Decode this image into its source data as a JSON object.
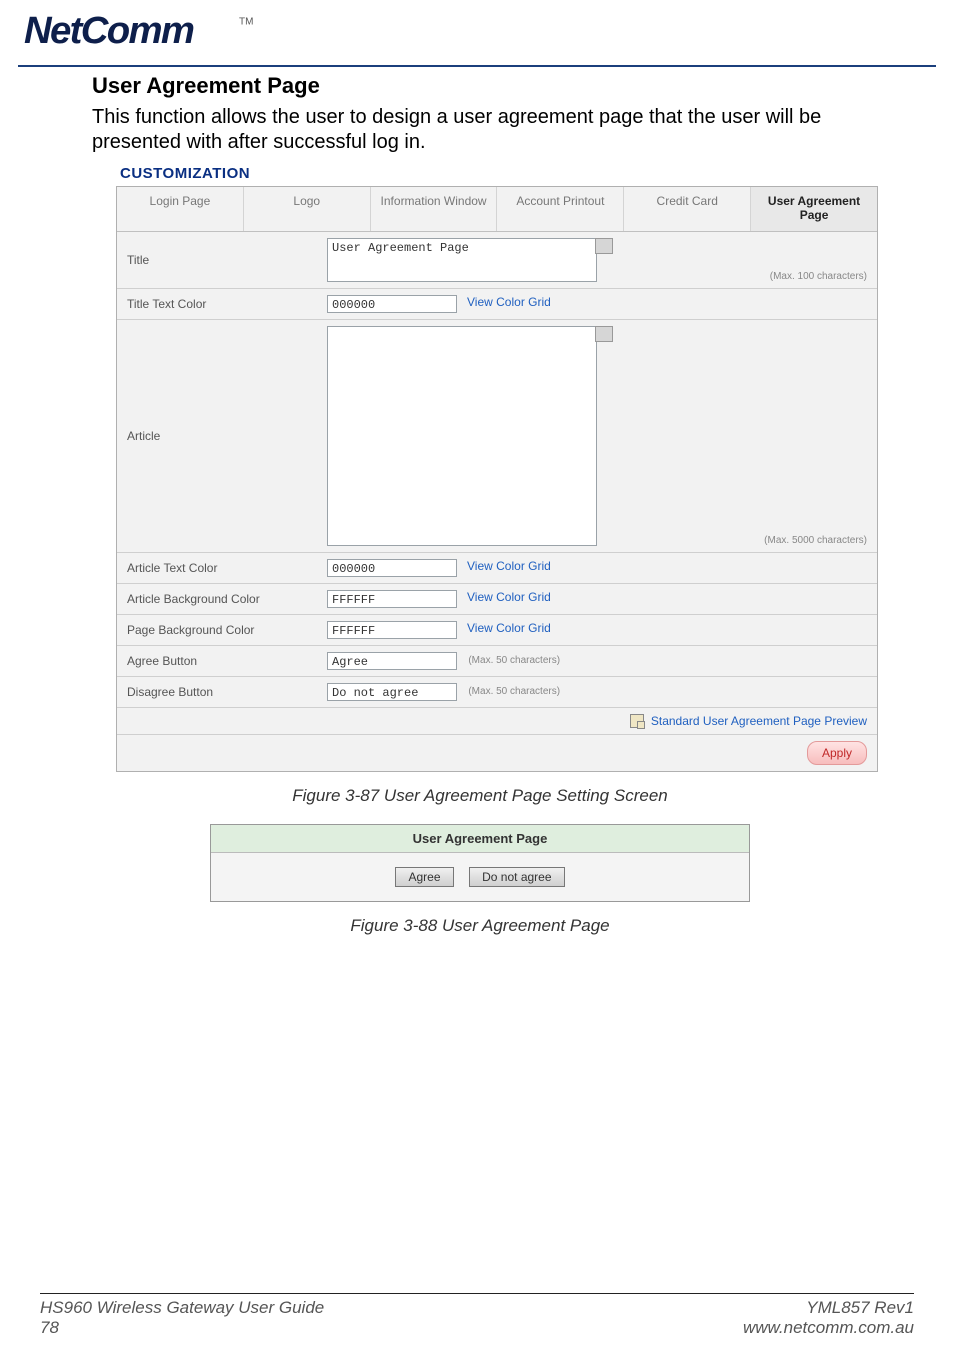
{
  "page": {
    "heading": "User Agreement Page",
    "intro": "This function allows the user to design a user agreement page that the user will be presented with after successful log in.",
    "customization_label": "CUSTOMIZATION"
  },
  "tabs": {
    "login": "Login Page",
    "logo": "Logo",
    "info": "Information Window",
    "printout": "Account Printout",
    "credit": "Credit Card",
    "agreement": "User Agreement Page"
  },
  "form": {
    "title_label": "Title",
    "title_value": "User Agreement Page",
    "title_hint": "(Max. 100 characters)",
    "title_color_label": "Title Text Color",
    "title_color_value": "000000",
    "view_grid": "View Color Grid",
    "article_label": "Article",
    "article_hint": "(Max. 5000 characters)",
    "article_color_label": "Article Text Color",
    "article_color_value": "000000",
    "article_bg_label": "Article Background Color",
    "article_bg_value": "FFFFFF",
    "page_bg_label": "Page Background Color",
    "page_bg_value": "FFFFFF",
    "agree_label": "Agree Button",
    "agree_value": "Agree",
    "agree_hint": "(Max. 50 characters)",
    "disagree_label": "Disagree Button",
    "disagree_value": "Do not agree",
    "disagree_hint": "(Max. 50 characters)",
    "preview_link": "Standard User Agreement Page Preview",
    "apply": "Apply"
  },
  "figure1": "Figure 3-87 User Agreement Page Setting Screen",
  "mini": {
    "header": "User Agreement Page",
    "agree": "Agree",
    "disagree": "Do not agree"
  },
  "figure2": "Figure 3-88 User Agreement Page",
  "footer": {
    "left1": "HS960 Wireless Gateway User Guide",
    "left2": "78",
    "right1": "YML857 Rev1",
    "right2": "www.netcomm.com.au"
  }
}
